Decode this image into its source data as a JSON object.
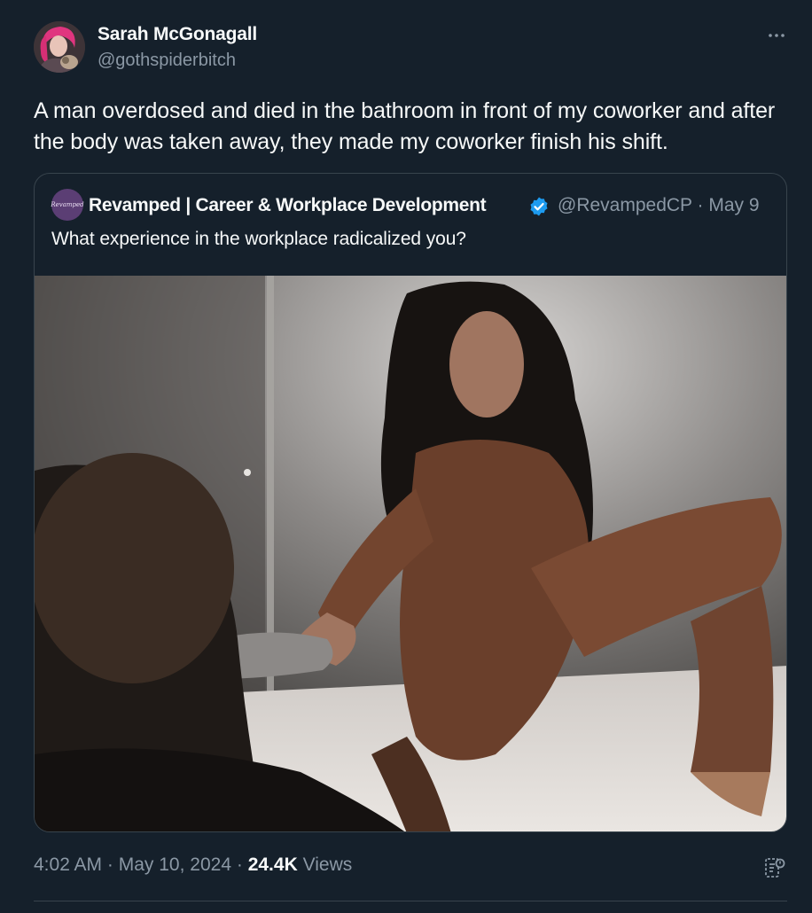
{
  "author": {
    "display_name": "Sarah McGonagall",
    "handle": "@gothspiderbitch"
  },
  "tweet": {
    "text": "A man overdosed and died in the bathroom in front of my coworker and after the body was taken away, they made my coworker finish his shift."
  },
  "quoted_tweet": {
    "avatar_text": "Revamped",
    "display_name": "Revamped | Career & Workplace Development",
    "handle": "@RevampedCP",
    "separator": "·",
    "date": "May 9",
    "text": "What experience in the workplace radicalized you?"
  },
  "footer": {
    "time": "4:02 AM",
    "separator": "·",
    "date": "May 10, 2024",
    "views_count": "24.4K",
    "views_label": "Views"
  },
  "icons": {
    "more": "more-horizontal-icon",
    "verified": "verified-badge-icon",
    "analytics": "analytics-icon"
  },
  "colors": {
    "background": "#15202b",
    "text": "#f7f9f9",
    "secondary_text": "#8b98a5",
    "border": "#38444d",
    "verified": "#1d9bf0"
  }
}
